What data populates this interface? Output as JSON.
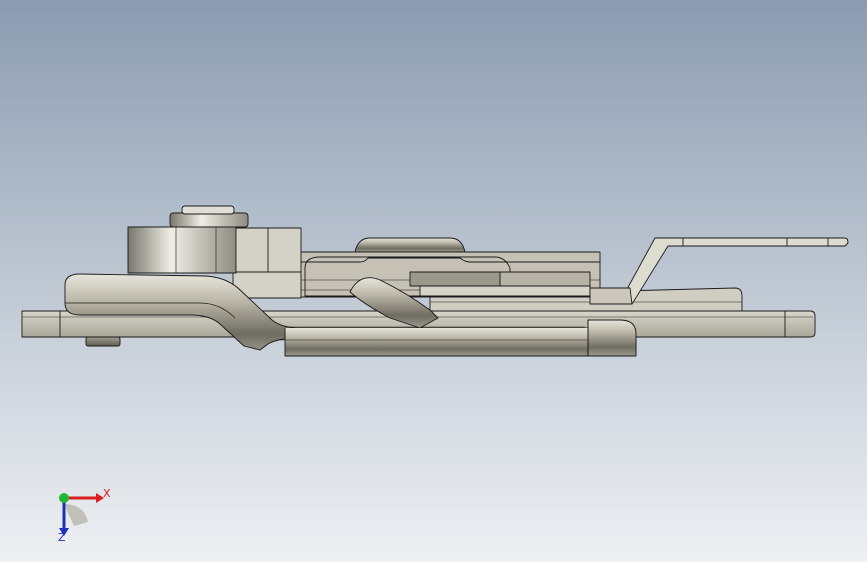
{
  "viewport": {
    "background_top": "#8e9db1",
    "background_bottom": "#eceff2",
    "part_color": "#c8c5b8",
    "edge_color": "#1a1a1a"
  },
  "triad": {
    "x_label": "X",
    "z_label": "Z",
    "x_color": "#d81e1e",
    "y_color": "#1fb832",
    "z_color": "#1f2fb8"
  }
}
